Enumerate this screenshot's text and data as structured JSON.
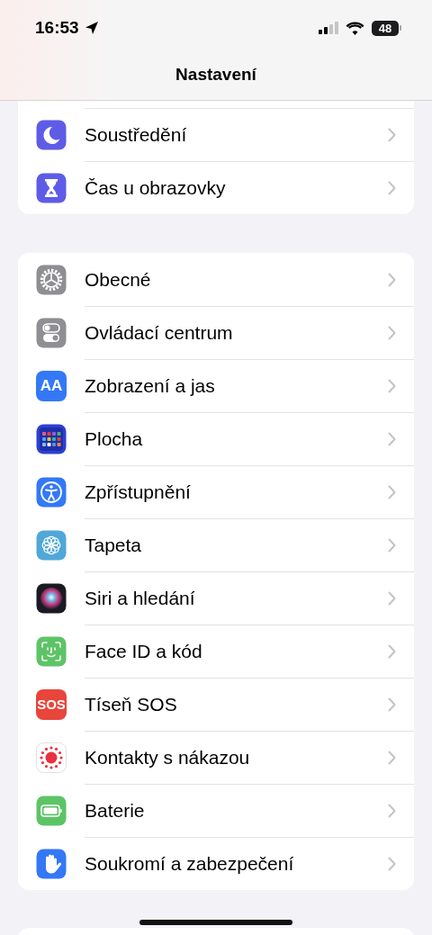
{
  "status_bar": {
    "time": "16:53",
    "battery": "48"
  },
  "title": "Nastavení",
  "groups": [
    {
      "items": [
        {
          "label": "Soustředění",
          "kind": "moon"
        },
        {
          "label": "Čas u obrazovky",
          "kind": "hourglass"
        }
      ]
    },
    {
      "items": [
        {
          "label": "Obecné",
          "kind": "gear"
        },
        {
          "label": "Ovládací centrum",
          "kind": "toggles"
        },
        {
          "label": "Zobrazení a jas",
          "kind": "textsize",
          "icon_text": "AA"
        },
        {
          "label": "Plocha",
          "kind": "grid"
        },
        {
          "label": "Zpřístupnění",
          "kind": "accessibility"
        },
        {
          "label": "Tapeta",
          "kind": "flower"
        },
        {
          "label": "Siri a hledání",
          "kind": "orb"
        },
        {
          "label": "Face ID a kód",
          "kind": "facescan"
        },
        {
          "label": "Tíseň SOS",
          "kind": "sos",
          "icon_text": "SOS"
        },
        {
          "label": "Kontakty s nákazou",
          "kind": "exposure"
        },
        {
          "label": "Baterie",
          "kind": "battery"
        },
        {
          "label": "Soukromí a zabezpečení",
          "kind": "hand"
        }
      ]
    }
  ]
}
